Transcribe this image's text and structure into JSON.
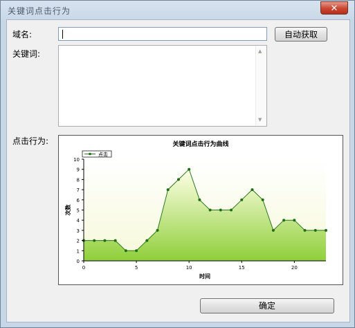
{
  "window": {
    "title": "关键词点击行为",
    "close_label": "✕"
  },
  "form": {
    "domain_label": "域名:",
    "domain_value": "",
    "auto_fetch_label": "自动获取",
    "keywords_label": "关键词:",
    "keywords_value": "",
    "click_behavior_label": "点击行为:"
  },
  "chart_data": {
    "type": "area",
    "title": "关键词点击行为曲线",
    "xlabel": "时间",
    "ylabel": "次数",
    "legend": [
      "点击"
    ],
    "xlim": [
      0,
      23
    ],
    "ylim": [
      0,
      10
    ],
    "x_ticks": [
      0,
      5,
      10,
      15,
      20
    ],
    "y_ticks": [
      0,
      1,
      2,
      3,
      4,
      5,
      6,
      7,
      8,
      9,
      10
    ],
    "grid": false,
    "legend_placement": "top-left",
    "colors": {
      "line": "#2a7a1e",
      "fill_top": "#ffffe6",
      "fill_bottom": "#8fcf3a",
      "marker": "#1e6e14"
    },
    "series": [
      {
        "name": "点击",
        "x": [
          0,
          1,
          2,
          3,
          4,
          5,
          6,
          7,
          8,
          9,
          10,
          11,
          12,
          13,
          14,
          15,
          16,
          17,
          18,
          19,
          20,
          21,
          22,
          23
        ],
        "y": [
          2,
          2,
          2,
          2,
          1,
          1,
          2,
          3,
          7,
          8,
          9,
          6,
          5,
          5,
          5,
          6,
          7,
          6,
          3,
          4,
          4,
          3,
          3,
          3
        ]
      }
    ]
  },
  "footer": {
    "ok_label": "确定"
  }
}
